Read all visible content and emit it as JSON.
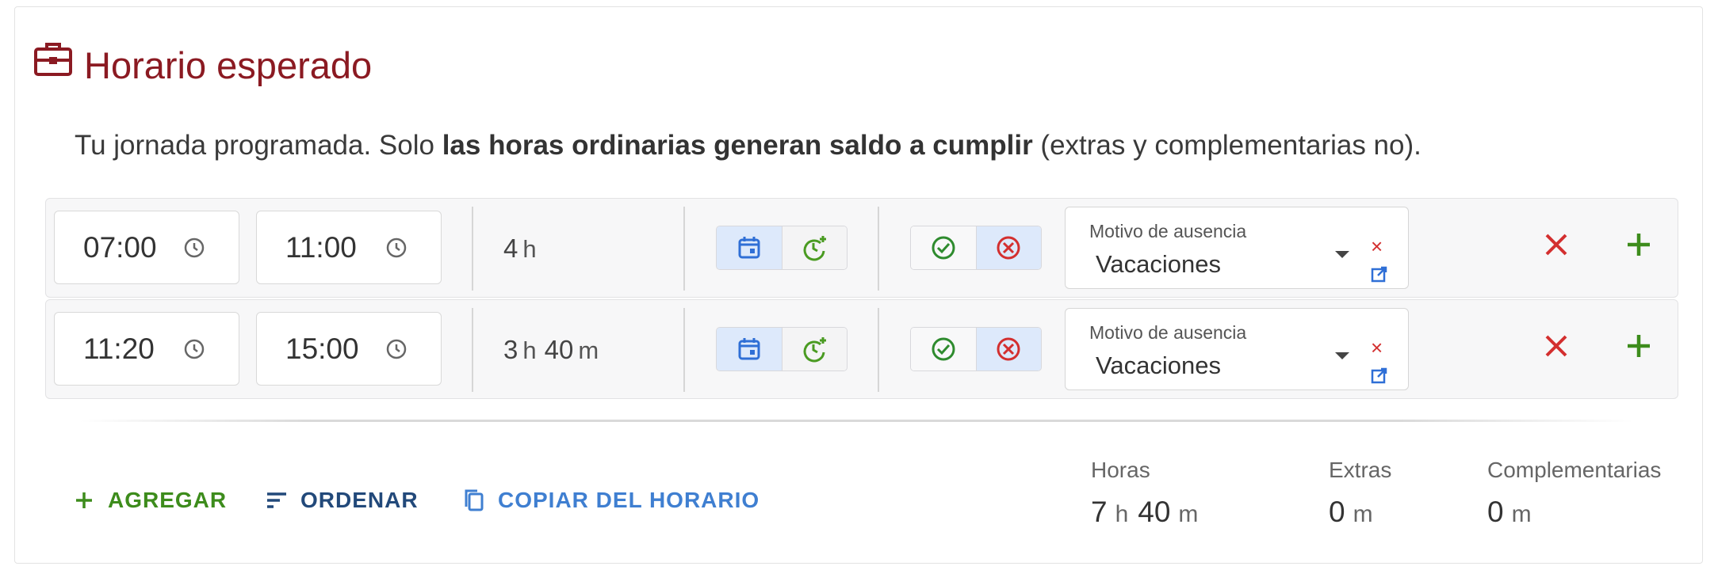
{
  "section": {
    "title": "Horario esperado",
    "icon": "briefcase-icon",
    "description": {
      "pre": "Tu jornada programada. Solo ",
      "bold": "las horas ordinarias generan saldo a cumplir",
      "post": " (extras y complementarias no)."
    }
  },
  "colors": {
    "title": "#8b1a22",
    "add_green": "#3d8c1c",
    "delete_red": "#d32f2f",
    "link_blue": "#3f7fd1",
    "selected_bg": "#dde9fb"
  },
  "rows": [
    {
      "start": "07:00",
      "end": "11:00",
      "duration": {
        "h": "4",
        "h_unit": "h"
      },
      "absence_label": "Motivo de ausencia",
      "absence_value": "Vacaciones",
      "clear": "×"
    },
    {
      "start": "11:20",
      "end": "15:00",
      "duration": {
        "h": "3",
        "h_unit": "h",
        "m": "40",
        "m_unit": "m"
      },
      "absence_label": "Motivo de ausencia",
      "absence_value": "Vacaciones",
      "clear": "×"
    }
  ],
  "actions": {
    "add": "AGREGAR",
    "sort": "ORDENAR",
    "copy": "COPIAR DEL HORARIO"
  },
  "totals": {
    "hours": {
      "label": "Horas",
      "h": "7",
      "h_unit": "h",
      "m": "40",
      "m_unit": "m"
    },
    "extras": {
      "label": "Extras",
      "m": "0",
      "m_unit": "m"
    },
    "complementary": {
      "label": "Complementarias",
      "m": "0",
      "m_unit": "m"
    }
  }
}
